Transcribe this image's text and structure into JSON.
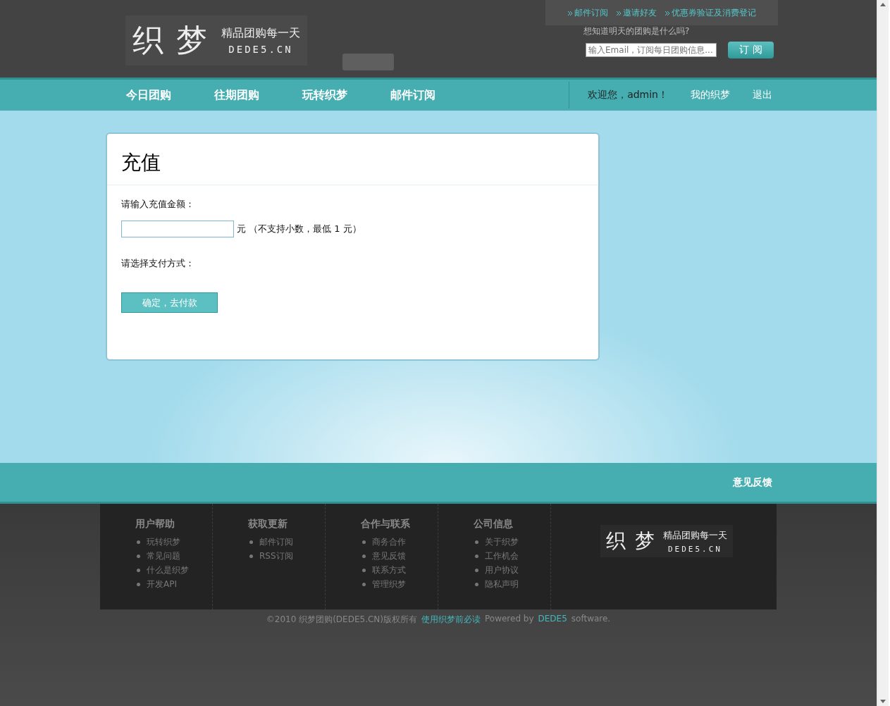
{
  "logo": {
    "mark": "织 梦",
    "slogan": "精品团购每一天",
    "domain": "DEDE5.CN"
  },
  "top_links": [
    {
      "label": "邮件订阅"
    },
    {
      "label": "邀请好友"
    },
    {
      "label": "优惠券验证及消费登记"
    }
  ],
  "subscribe": {
    "prompt": "想知道明天的团购是什么吗?",
    "placeholder": "输入Email，订阅每日团购信息...",
    "button": "订 阅"
  },
  "nav": {
    "items": [
      {
        "label": "今日团购",
        "selected": false
      },
      {
        "label": "往期团购",
        "selected": false
      },
      {
        "label": "玩转织梦",
        "selected": false
      },
      {
        "label": "邮件订阅",
        "selected": false
      }
    ],
    "welcome": "欢迎您，admin！",
    "user_links": [
      "我的织梦",
      "退出"
    ]
  },
  "recharge": {
    "title": "充值",
    "amount_label": "请输入充值金额：",
    "unit": "元",
    "hint": "（不支持小数，最低 1 元）",
    "method_label": "请选择支付方式：",
    "submit": "确定，去付款"
  },
  "feedback": "意见反馈",
  "footer": {
    "columns": [
      {
        "title": "用户帮助",
        "links": [
          "玩转织梦",
          "常见问题",
          "什么是织梦",
          "开发API"
        ]
      },
      {
        "title": "获取更新",
        "links": [
          "邮件订阅",
          "RSS订阅"
        ]
      },
      {
        "title": "合作与联系",
        "links": [
          "商务合作",
          "意见反馈",
          "联系方式",
          "管理织梦"
        ]
      },
      {
        "title": "公司信息",
        "links": [
          "关于织梦",
          "工作机会",
          "用户协议",
          "隐私声明"
        ]
      }
    ],
    "logo": {
      "mark": "织 梦",
      "slogan": "精品团购每一天",
      "domain": "DEDE5.CN"
    },
    "copyright": "©2010 织梦团购(DEDE5.CN)版权所有",
    "guide_link": "使用织梦前必读",
    "powered_prefix": "Powered by",
    "powered_link": "DEDE5",
    "powered_suffix": "software."
  }
}
